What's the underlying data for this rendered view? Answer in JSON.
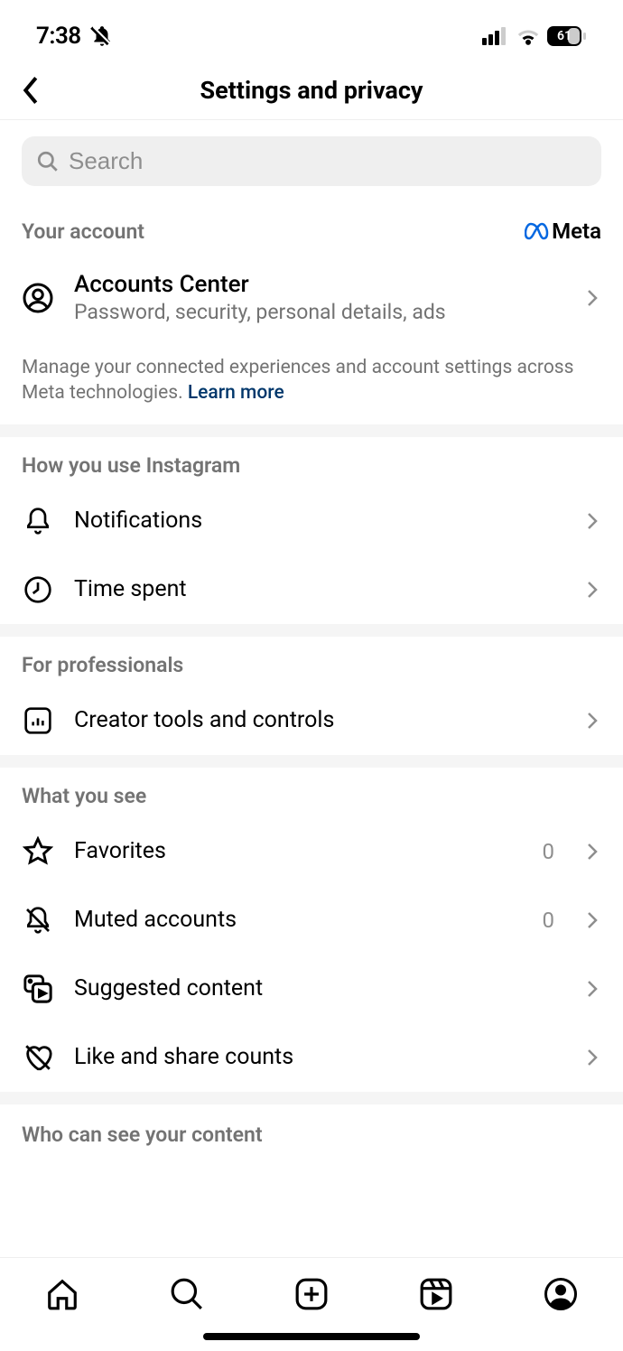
{
  "status": {
    "time": "7:38",
    "battery": "61"
  },
  "header": {
    "title": "Settings and privacy"
  },
  "search": {
    "placeholder": "Search"
  },
  "account": {
    "section_title": "Your account",
    "meta_label": "Meta",
    "ac_title": "Accounts Center",
    "ac_sub": "Password, security, personal details, ads",
    "note_text": "Manage your connected experiences and account settings across Meta technologies. ",
    "note_link": "Learn more"
  },
  "usage": {
    "section_title": "How you use Instagram",
    "notifications": "Notifications",
    "time_spent": "Time spent"
  },
  "pro": {
    "section_title": "For professionals",
    "creator_tools": "Creator tools and controls"
  },
  "what_you_see": {
    "section_title": "What you see",
    "favorites": "Favorites",
    "favorites_count": "0",
    "muted": "Muted accounts",
    "muted_count": "0",
    "suggested": "Suggested content",
    "like_share": "Like and share counts"
  },
  "truncated_section": "Who can see your content"
}
